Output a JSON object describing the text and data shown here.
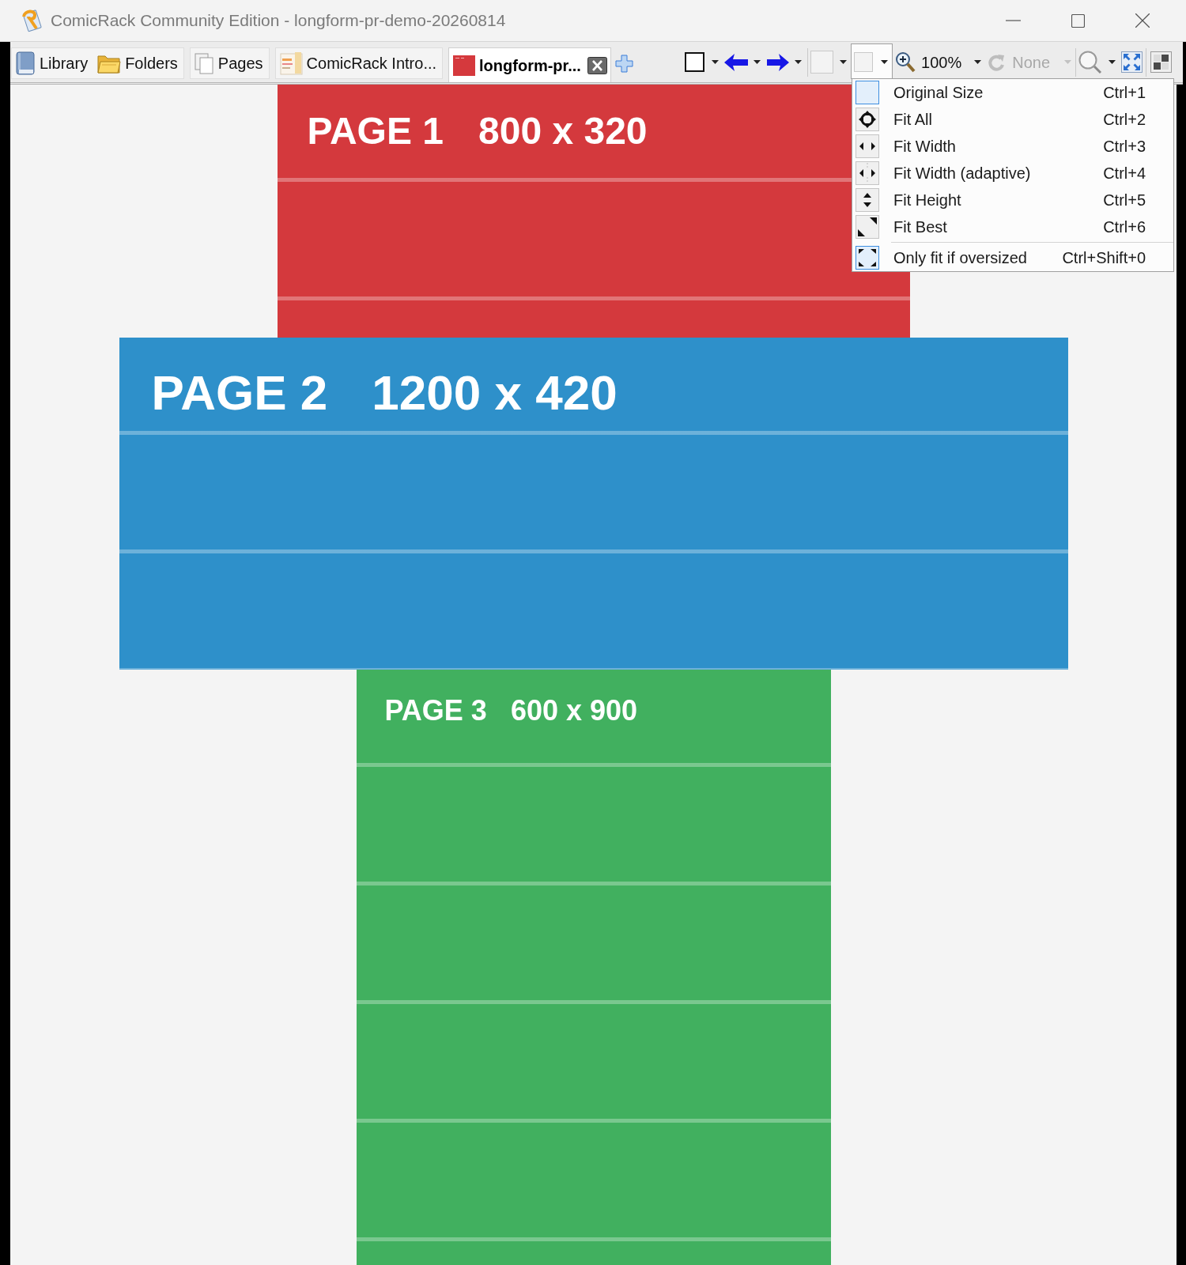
{
  "window": {
    "title": "ComicRack Community Edition - longform-pr-demo-20260814"
  },
  "tabs": [
    {
      "label": "Library",
      "selected": false
    },
    {
      "label": "Folders",
      "selected": false
    },
    {
      "label": "Pages",
      "selected": false
    },
    {
      "label": "ComicRack Intro...",
      "selected": false
    },
    {
      "label": "longform-pr...",
      "selected": true
    }
  ],
  "toolbar": {
    "fit_mode": {
      "expanded": true,
      "menu": [
        {
          "items": [
            {
              "label": "Original Size",
              "shortcut": "Ctrl+1",
              "checked": true
            },
            {
              "label": "Fit All",
              "shortcut": "Ctrl+2",
              "checked": false
            },
            {
              "label": "Fit Width",
              "shortcut": "Ctrl+3",
              "checked": false
            },
            {
              "label": "Fit Width (adaptive)",
              "shortcut": "Ctrl+4",
              "checked": false
            },
            {
              "label": "Fit Height",
              "shortcut": "Ctrl+5",
              "checked": false
            },
            {
              "label": "Fit Best",
              "shortcut": "Ctrl+6",
              "checked": false
            }
          ]
        },
        {
          "items": [
            {
              "label": "Only fit if oversized",
              "shortcut": "Ctrl+Shift+0",
              "checked": true
            }
          ]
        }
      ]
    },
    "zoom": {
      "value": "100%",
      "disabled": false
    },
    "rotation": {
      "value": "None",
      "disabled": true
    }
  },
  "pages": [
    {
      "title": "PAGE 1",
      "size": "800 x 320",
      "color": "#d4393d"
    },
    {
      "title": "PAGE 2",
      "size": "1200 x 420",
      "color": "#2e90ca"
    },
    {
      "title": "PAGE 3",
      "size": "600 x 900",
      "color": "#41b05f"
    }
  ]
}
